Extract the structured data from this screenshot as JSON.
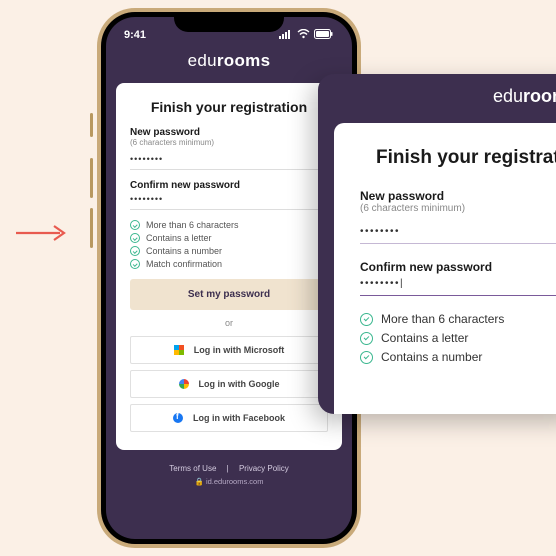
{
  "statusbar": {
    "time": "9:41"
  },
  "brand": {
    "edu": "edu",
    "rooms": "rooms"
  },
  "card": {
    "title": "Finish your registration",
    "new_pw_label": "New password",
    "new_pw_hint": "(6 characters minimum)",
    "new_pw_value": "••••••••",
    "confirm_label": "Confirm new password",
    "confirm_value": "••••••••",
    "reqs": {
      "r1": "More than 6 characters",
      "r2": "Contains a letter",
      "r3": "Contains a number",
      "r4": "Match confirmation"
    },
    "submit": "Set my password",
    "or": "or",
    "social": {
      "ms": "Log in with Microsoft",
      "gg": "Log in with Google",
      "fb": "Log in with Facebook"
    }
  },
  "footer": {
    "terms": "Terms of Use",
    "sep": "|",
    "privacy": "Privacy Policy",
    "url": "🔒 id.edurooms.com"
  },
  "zoom": {
    "title": "Finish your registration",
    "new_pw_label": "New password",
    "new_pw_hint": "(6 characters minimum)",
    "new_pw_value": "••••••••",
    "confirm_label": "Confirm new password",
    "confirm_value": "••••••••|",
    "reqs": {
      "r1": "More than 6 characters",
      "r2": "Contains a letter",
      "r3": "Contains a number"
    }
  }
}
